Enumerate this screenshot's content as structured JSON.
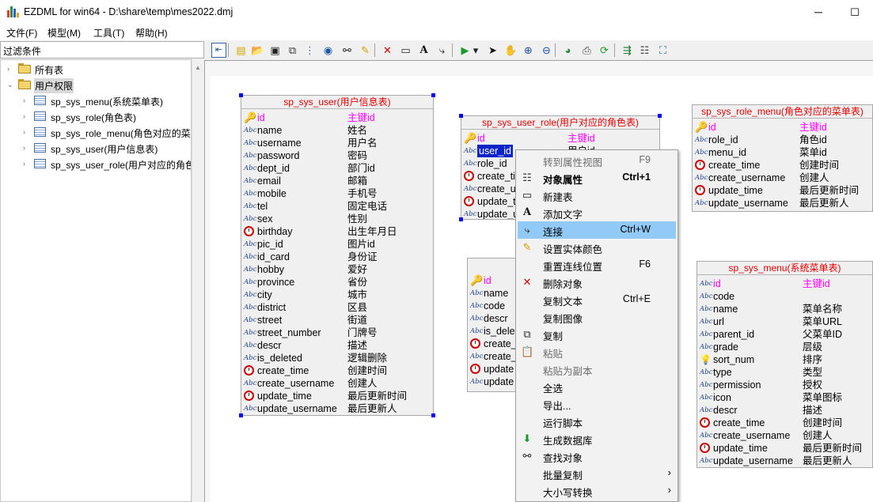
{
  "window": {
    "title": "EZDML for win64 - D:\\share\\temp\\mes2022.dmj",
    "minimize": "─",
    "maximize": "☐",
    "close": "✕"
  },
  "menubar": [
    "文件(F)",
    "模型(M)",
    "工具(T)",
    "帮助(H)"
  ],
  "sidebar": {
    "filter_label": "过滤条件",
    "tree": [
      {
        "label": "所有表",
        "kind": "folder",
        "level": 0,
        "expanded": false,
        "selected": false
      },
      {
        "label": "用户权限",
        "kind": "folder",
        "level": 0,
        "expanded": true,
        "selected": true
      },
      {
        "label": "sp_sys_menu(系统菜单表)",
        "kind": "table",
        "level": 1
      },
      {
        "label": "sp_sys_role(角色表)",
        "kind": "table",
        "level": 1
      },
      {
        "label": "sp_sys_role_menu(角色对应的菜",
        "kind": "table",
        "level": 1
      },
      {
        "label": "sp_sys_user(用户信息表)",
        "kind": "table",
        "level": 1
      },
      {
        "label": "sp_sys_user_role(用户对应的角色",
        "kind": "table",
        "level": 1
      }
    ]
  },
  "toolbar": {
    "icons": [
      "panel-toggle-icon",
      "new-icon",
      "open-icon",
      "save-icon",
      "copy-model-icon",
      "tree-icon",
      "globe-icon",
      "binoculars-icon",
      "highlight-icon",
      "delete-icon",
      "rect-icon",
      "text-icon",
      "link-icon",
      "run-icon",
      "dropdown-icon",
      "pointer-icon",
      "hand-icon",
      "zoom-in-icon",
      "zoom-out-icon",
      "eye-icon",
      "print-icon",
      "refresh-icon",
      "generate-icon",
      "properties-icon",
      "fit-icon"
    ]
  },
  "colors": {
    "entity_title": "#e00000",
    "primary_key": "#ff00ff",
    "menu_highlight": "#91c9f7",
    "selection": "#0a24c8"
  },
  "entities": [
    {
      "id": "sp_sys_user",
      "title": "sp_sys_user(用户信息表)",
      "fields": [
        {
          "name": "id",
          "comment": "主键id",
          "icon": "key",
          "pk": true
        },
        {
          "name": "name",
          "comment": "姓名",
          "icon": "abc"
        },
        {
          "name": "username",
          "comment": "用户名",
          "icon": "abc"
        },
        {
          "name": "password",
          "comment": "密码",
          "icon": "abc"
        },
        {
          "name": "dept_id",
          "comment": "部门id",
          "icon": "abc"
        },
        {
          "name": "email",
          "comment": "邮箱",
          "icon": "abc"
        },
        {
          "name": "mobile",
          "comment": "手机号",
          "icon": "abc"
        },
        {
          "name": "tel",
          "comment": "固定电话",
          "icon": "abc"
        },
        {
          "name": "sex",
          "comment": "性别",
          "icon": "abc"
        },
        {
          "name": "birthday",
          "comment": "出生年月日",
          "icon": "clock"
        },
        {
          "name": "pic_id",
          "comment": "图片id",
          "icon": "abc"
        },
        {
          "name": "id_card",
          "comment": "身份证",
          "icon": "abc"
        },
        {
          "name": "hobby",
          "comment": "爱好",
          "icon": "abc"
        },
        {
          "name": "province",
          "comment": "省份",
          "icon": "abc"
        },
        {
          "name": "city",
          "comment": "城市",
          "icon": "abc"
        },
        {
          "name": "district",
          "comment": "区县",
          "icon": "abc"
        },
        {
          "name": "street",
          "comment": "街道",
          "icon": "abc"
        },
        {
          "name": "street_number",
          "comment": "门牌号",
          "icon": "abc"
        },
        {
          "name": "descr",
          "comment": "描述",
          "icon": "abc"
        },
        {
          "name": "is_deleted",
          "comment": "逻辑删除",
          "icon": "abc"
        },
        {
          "name": "create_time",
          "comment": "创建时间",
          "icon": "clock"
        },
        {
          "name": "create_username",
          "comment": "创建人",
          "icon": "abc"
        },
        {
          "name": "update_time",
          "comment": "最后更新时间",
          "icon": "clock"
        },
        {
          "name": "update_username",
          "comment": "最后更新人",
          "icon": "abc"
        }
      ]
    },
    {
      "id": "sp_sys_user_role",
      "title": "sp_sys_user_role(用户对应的角色表)",
      "fields": [
        {
          "name": "id",
          "comment": "主键id",
          "icon": "key",
          "pk": true
        },
        {
          "name": "user_id",
          "comment": "用户id",
          "icon": "abc",
          "selected": true
        },
        {
          "name": "role_id",
          "comment": "",
          "icon": "abc"
        },
        {
          "name": "create_ti",
          "comment": "",
          "icon": "clock"
        },
        {
          "name": "create_u",
          "comment": "",
          "icon": "abc"
        },
        {
          "name": "update_t",
          "comment": "",
          "icon": "clock"
        },
        {
          "name": "update_u",
          "comment": "",
          "icon": "abc"
        }
      ]
    },
    {
      "id": "sp_sys_role",
      "title": "",
      "fields": [
        {
          "name": "id",
          "comment": "",
          "icon": "key",
          "pk": true
        },
        {
          "name": "name",
          "comment": "",
          "icon": "abc"
        },
        {
          "name": "code",
          "comment": "",
          "icon": "abc"
        },
        {
          "name": "descr",
          "comment": "",
          "icon": "abc"
        },
        {
          "name": "is_dele",
          "comment": "",
          "icon": "abc"
        },
        {
          "name": "create_",
          "comment": "",
          "icon": "clock"
        },
        {
          "name": "create_",
          "comment": "",
          "icon": "abc"
        },
        {
          "name": "update",
          "comment": "",
          "icon": "clock"
        },
        {
          "name": "update",
          "comment": "",
          "icon": "abc"
        }
      ]
    },
    {
      "id": "sp_sys_role_menu",
      "title": "sp_sys_role_menu(角色对应的菜单表)",
      "fields": [
        {
          "name": "id",
          "comment": "主键id",
          "icon": "key",
          "pk": true
        },
        {
          "name": "role_id",
          "comment": "角色id",
          "icon": "abc"
        },
        {
          "name": "menu_id",
          "comment": "菜单id",
          "icon": "abc"
        },
        {
          "name": "create_time",
          "comment": "创建时间",
          "icon": "clock"
        },
        {
          "name": "create_username",
          "comment": "创建人",
          "icon": "abc"
        },
        {
          "name": "update_time",
          "comment": "最后更新时间",
          "icon": "clock"
        },
        {
          "name": "update_username",
          "comment": "最后更新人",
          "icon": "abc"
        }
      ]
    },
    {
      "id": "sp_sys_menu",
      "title": "sp_sys_menu(系统菜单表)",
      "fields": [
        {
          "name": "id",
          "comment": "主键id",
          "icon": "abc",
          "pk": true
        },
        {
          "name": "code",
          "comment": "",
          "icon": "abc"
        },
        {
          "name": "name",
          "comment": "菜单名称",
          "icon": "abc"
        },
        {
          "name": "url",
          "comment": "菜单URL",
          "icon": "abc"
        },
        {
          "name": "parent_id",
          "comment": "父菜单ID",
          "icon": "abc"
        },
        {
          "name": "grade",
          "comment": "层级",
          "icon": "abc"
        },
        {
          "name": "sort_num",
          "comment": "排序",
          "icon": "bulb"
        },
        {
          "name": "type",
          "comment": "类型",
          "icon": "abc"
        },
        {
          "name": "permission",
          "comment": "授权",
          "icon": "abc"
        },
        {
          "name": "icon",
          "comment": "菜单图标",
          "icon": "abc"
        },
        {
          "name": "descr",
          "comment": "描述",
          "icon": "abc"
        },
        {
          "name": "create_time",
          "comment": "创建时间",
          "icon": "clock"
        },
        {
          "name": "create_username",
          "comment": "创建人",
          "icon": "abc"
        },
        {
          "name": "update_time",
          "comment": "最后更新时间",
          "icon": "clock"
        },
        {
          "name": "update_username",
          "comment": "最后更新人",
          "icon": "abc"
        }
      ]
    }
  ],
  "context_menu": [
    {
      "label": "转到属性视图",
      "shortcut": "F9",
      "icon": "",
      "disabled": true
    },
    {
      "label": "对象属性",
      "shortcut": "Ctrl+1",
      "icon": "properties-icon",
      "bold": true
    },
    {
      "label": "新建表",
      "shortcut": "",
      "icon": "new-table-icon"
    },
    {
      "label": "添加文字",
      "shortcut": "",
      "icon": "text-icon"
    },
    {
      "label": "连接",
      "shortcut": "Ctrl+W",
      "icon": "link-icon",
      "hot": true
    },
    {
      "label": "设置实体颜色",
      "shortcut": "",
      "icon": "color-icon"
    },
    {
      "label": "重置连线位置",
      "shortcut": "F6",
      "icon": ""
    },
    {
      "label": "删除对象",
      "shortcut": "",
      "icon": "delete-icon"
    },
    {
      "label": "复制文本",
      "shortcut": "Ctrl+E",
      "icon": ""
    },
    {
      "label": "复制图像",
      "shortcut": "",
      "icon": ""
    },
    {
      "label": "复制",
      "shortcut": "",
      "icon": "copy-icon"
    },
    {
      "label": "粘贴",
      "shortcut": "",
      "icon": "paste-icon",
      "disabled": true
    },
    {
      "label": "粘贴为副本",
      "shortcut": "",
      "icon": "",
      "disabled": true
    },
    {
      "label": "全选",
      "shortcut": "",
      "icon": ""
    },
    {
      "label": "导出...",
      "shortcut": "",
      "icon": ""
    },
    {
      "label": "运行脚本",
      "shortcut": "",
      "icon": ""
    },
    {
      "label": "生成数据库",
      "shortcut": "",
      "icon": "generate-db-icon"
    },
    {
      "label": "查找对象",
      "shortcut": "",
      "icon": "binoculars-icon"
    },
    {
      "label": "批量复制",
      "shortcut": "",
      "icon": "",
      "submenu": true
    },
    {
      "label": "大小写转换",
      "shortcut": "",
      "icon": "",
      "submenu": true
    }
  ]
}
